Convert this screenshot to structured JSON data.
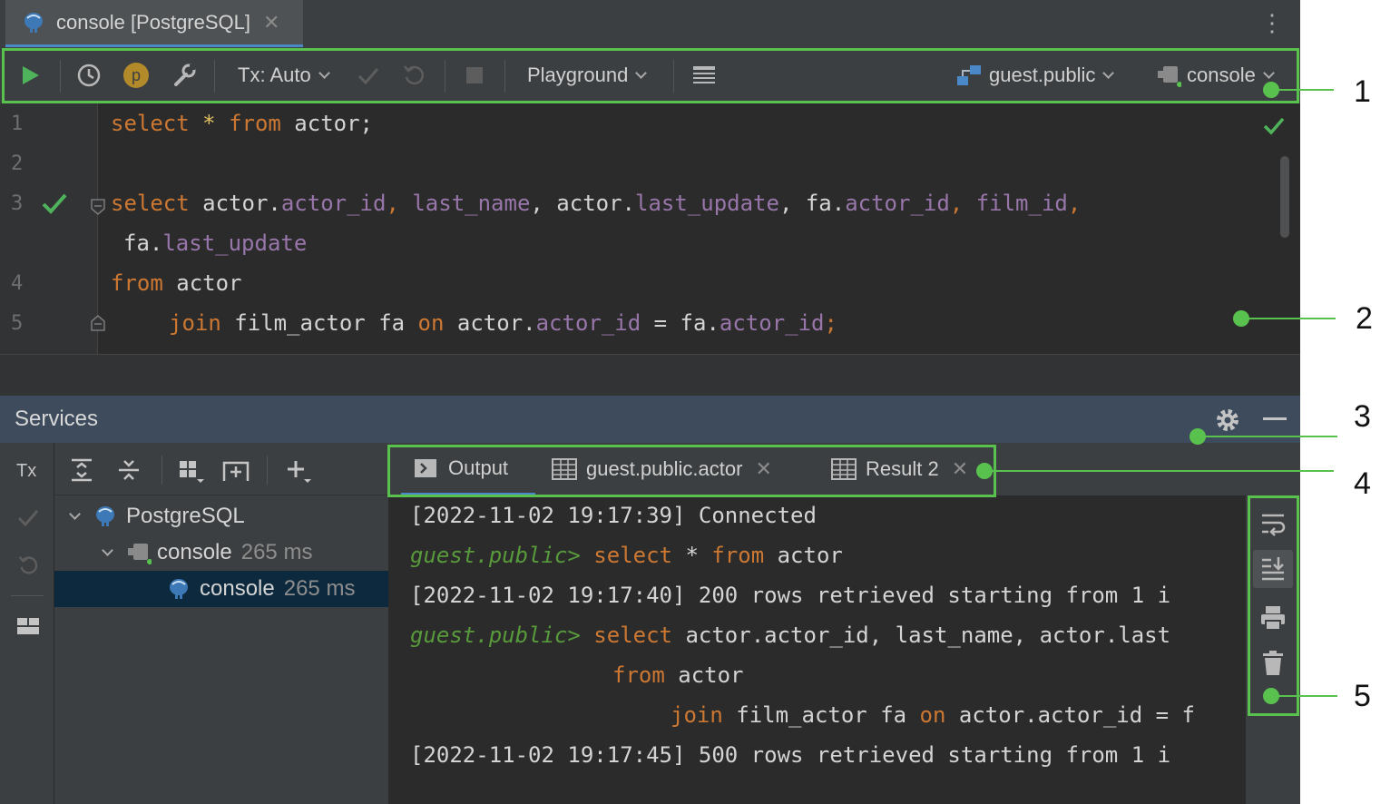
{
  "editor_tab": {
    "label": "console [PostgreSQL]"
  },
  "toolbar": {
    "profiler_badge": "p",
    "tx_label": "Tx: Auto",
    "mode_label": "Playground",
    "schema_label": "guest.public",
    "session_label": "console"
  },
  "editor": {
    "line_numbers": [
      "1",
      "2",
      "3",
      "4",
      "5"
    ],
    "line1": {
      "kw1": "select",
      "star": " * ",
      "kw2": "from",
      "rest": " actor;"
    },
    "line3": {
      "kw": "select",
      "p1": " actor.",
      "f1": "actor_id",
      "c1": ", ",
      "f2": "last_name",
      "c2": ", actor.",
      "f3": "last_update",
      "c3": ", fa.",
      "f4": "actor_id",
      "c4": ", ",
      "f5": "film_id",
      "c5": ","
    },
    "line3b": {
      "p1": "fa.",
      "f1": "last_update"
    },
    "line4": {
      "kw": "from",
      "rest": " actor"
    },
    "line5": {
      "kw1": "join",
      "p1": " film_actor fa ",
      "kw2": "on",
      "p2": " actor.",
      "f1": "actor_id",
      "p3": " = fa.",
      "f2": "actor_id",
      "p4": ";"
    }
  },
  "services": {
    "title": "Services",
    "tx_strip_label": "Tx",
    "tree": [
      {
        "label": "PostgreSQL",
        "meta": ""
      },
      {
        "label": "console",
        "meta": "265 ms"
      },
      {
        "label": "console",
        "meta": "265 ms"
      }
    ],
    "tabs": [
      {
        "label": "Output"
      },
      {
        "label": "guest.public.actor"
      },
      {
        "label": "Result 2"
      }
    ],
    "output": {
      "l1": "[2022-11-02 19:17:39] Connected",
      "l2_prompt": "guest.public>",
      "l2_kw1": " select",
      "l2_mid": " * ",
      "l2_kw2": "from",
      "l2_rest": " actor",
      "l3": "[2022-11-02 19:17:40] 200 rows retrieved starting from 1 i",
      "l4_prompt": "guest.public>",
      "l4_kw": " select",
      "l4_rest": " actor.actor_id, last_name, actor.last",
      "l5_kw": "from",
      "l5_rest": " actor",
      "l6_kw": "join",
      "l6_p1": " film_actor fa ",
      "l6_kw2": "on",
      "l6_rest": " actor.actor_id = f",
      "l7": "[2022-11-02 19:17:45] 500 rows retrieved starting from 1 i"
    }
  },
  "callouts": [
    "1",
    "2",
    "3",
    "4",
    "5"
  ],
  "colors": {
    "annotation": "#59c14e",
    "keyword": "#cc7832",
    "field": "#9876aa",
    "prompt": "#589a3b"
  }
}
